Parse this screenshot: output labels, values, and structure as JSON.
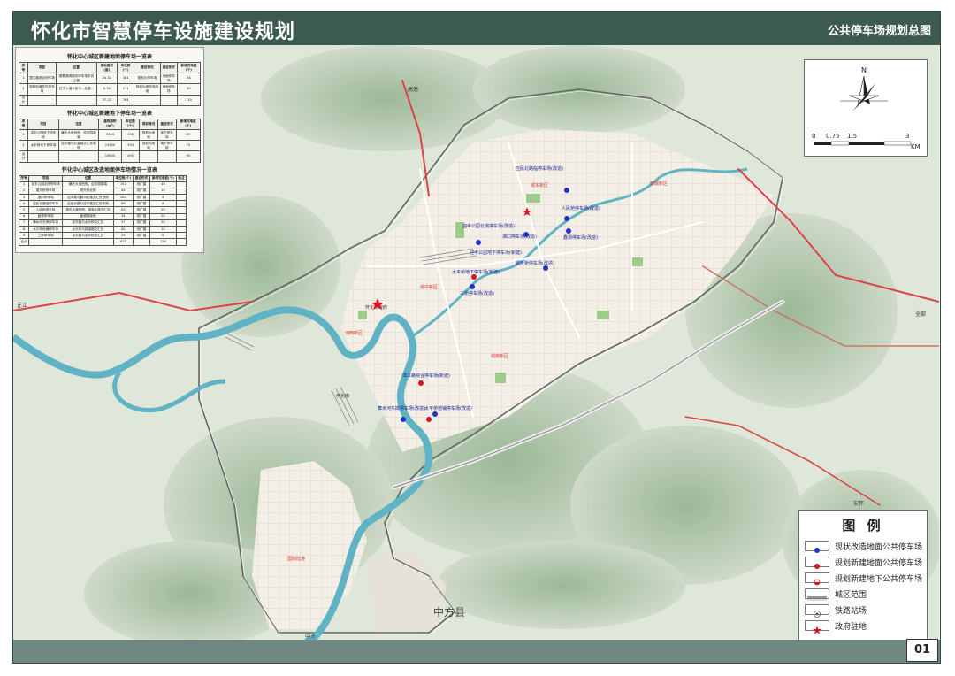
{
  "header": {
    "title": "怀化市智慧停车设施建设规划",
    "subtitle": "公共停车场规划总图"
  },
  "page_number": "01",
  "compass": {
    "north": "N",
    "scale_ticks": [
      "0",
      "0.75",
      "1.5",
      "3"
    ],
    "unit": "KM"
  },
  "legend": {
    "title": "图 例",
    "items": [
      {
        "label": "现状改造地面公共停车场",
        "icon": "blue-dot-icon",
        "color": "#2233cc"
      },
      {
        "label": "规划新建地面公共停车场",
        "icon": "red-dot-icon",
        "color": "#dd1122"
      },
      {
        "label": "规划新建地下公共停车场",
        "icon": "red-half-dot-icon",
        "color": "#dd1122"
      },
      {
        "label": "城区范围",
        "icon": "double-line-icon",
        "color": "#555555"
      },
      {
        "label": "铁路站场",
        "icon": "station-ring-icon",
        "color": "#555555"
      },
      {
        "label": "政府驻地",
        "icon": "red-star-icon",
        "color": "#dd1122"
      }
    ]
  },
  "tables": [
    {
      "title": "怀化中心城区新建地面停车场一览表",
      "headers": [
        "序号",
        "项目",
        "位置",
        "用地面积(亩)",
        "车位数(个)",
        "建设情况",
        "建设形式",
        "新增充电桩(个)"
      ],
      "rows": [
        [
          "1",
          "潭江路综合停车场",
          "顺着锦绣现状停车场东向工程",
          "24.32",
          "381",
          "规划为停车场",
          "地面停车场",
          "34"
        ],
        [
          "2",
          "现象街道花坑停车场",
          "位于人潮大街与...北道...",
          "6.38",
          "131",
          "规划为停车场用地",
          "地面停车场",
          "80"
        ],
        [
          "合计",
          "",
          "",
          "37.22",
          "764",
          "",
          "",
          "110"
        ]
      ]
    },
    {
      "title": "怀化中心城区新建地下停车场一览表",
      "headers": [
        "序号",
        "项目",
        "位置",
        "建筑面积(m²)",
        "车位数(个)",
        "现状情况",
        "建设形式",
        "新增充电桩(个)"
      ],
      "rows": [
        [
          "1",
          "迎丰公园地下停车场",
          "横天大道西侧，迎丰园南端",
          "5344",
          "136",
          "规划为用地",
          "地下停车场",
          "20"
        ],
        [
          "2",
          "太平桥地下停车场",
          "迎丰路与红星路交汇处南侧",
          "14500",
          "394",
          "规划为用地",
          "地下停车场",
          "70"
        ],
        [
          "合计",
          "",
          "",
          "19800",
          "490",
          "",
          "",
          "90"
        ]
      ]
    },
    {
      "title": "怀化中心城区改造地面停车场情况一览表",
      "headers": [
        "序号",
        "项目",
        "位置",
        "车位数(个)",
        "建设形式",
        "新增充电桩(个)",
        "备注"
      ],
      "rows": [
        [
          "1",
          "迎丰公园北侧停车场",
          "横天大道西侧，迎丰园南端",
          "152",
          "改扩建",
          "40",
          ""
        ],
        [
          "2",
          "顺天桥停车场",
          "顺天桥北侧",
          "64",
          "改扩建",
          "10",
          ""
        ],
        [
          "3",
          "潭口停车场",
          "迎丰路与鹤州北路交汇处西侧",
          "284",
          "改扩建",
          "6",
          ""
        ],
        [
          "4",
          "应民北路临停车场",
          "应民北路与迎丰路交汇处东侧",
          "88",
          "改扩建",
          "8",
          ""
        ],
        [
          "5",
          "人民桥停车场",
          "湖天大道西侧，锦溪北路交汇处",
          "62",
          "改扩建",
          "20",
          ""
        ],
        [
          "6",
          "鑫源停车场",
          "鑫源路南侧",
          "34",
          "改扩建",
          "20",
          ""
        ],
        [
          "7",
          "舞水河东岸停车场",
          "迎丰路与太平桥交汇处",
          "57",
          "改扩建",
          "20",
          ""
        ],
        [
          "8",
          "太平桥地铺停车场",
          "太平桥与锦溪路交汇处",
          "62",
          "改扩建",
          "10",
          ""
        ],
        [
          "9",
          "三桥停车场",
          "迎丰路与太平桥交汇处",
          "29",
          "改扩建",
          "6",
          ""
        ],
        [
          "合计",
          "",
          "",
          "832",
          "",
          "126",
          ""
        ]
      ]
    }
  ],
  "map_labels": {
    "county": "中方县",
    "east_road": "全部",
    "southeast_road": "安怀",
    "west_road": "芷江",
    "south_road": "中方",
    "north_road": "高速",
    "gov": "怀化市政府",
    "rail_label": "怀化南",
    "district1": "城东新区",
    "district2": "河西新区",
    "district3": "城南新区",
    "district4": "城中新区",
    "district5": "鹤城新区",
    "district6": "国际陆港"
  },
  "parking_labels": [
    {
      "text": "应民北路临停车场(改造)",
      "kind": "blue"
    },
    {
      "text": "迎丰公园北侧停车场(改造)",
      "kind": "blue"
    },
    {
      "text": "潭口停车场(改造)",
      "kind": "blue"
    },
    {
      "text": "人民桥停车场(改造)",
      "kind": "blue"
    },
    {
      "text": "鑫源停车场(改造)",
      "kind": "blue"
    },
    {
      "text": "顺天桥停车场(改造)",
      "kind": "blue"
    },
    {
      "text": "太平桥地下停车场(新建)",
      "kind": "red"
    },
    {
      "text": "三桥停车场(改造)",
      "kind": "blue"
    },
    {
      "text": "迎丰公园地下停车场(新建)",
      "kind": "red"
    },
    {
      "text": "舞水河东岸停车场(改造)",
      "kind": "blue"
    },
    {
      "text": "太平桥地铺停车场(改造)",
      "kind": "blue"
    },
    {
      "text": "潭江路综合停车场(新建)",
      "kind": "red"
    }
  ]
}
